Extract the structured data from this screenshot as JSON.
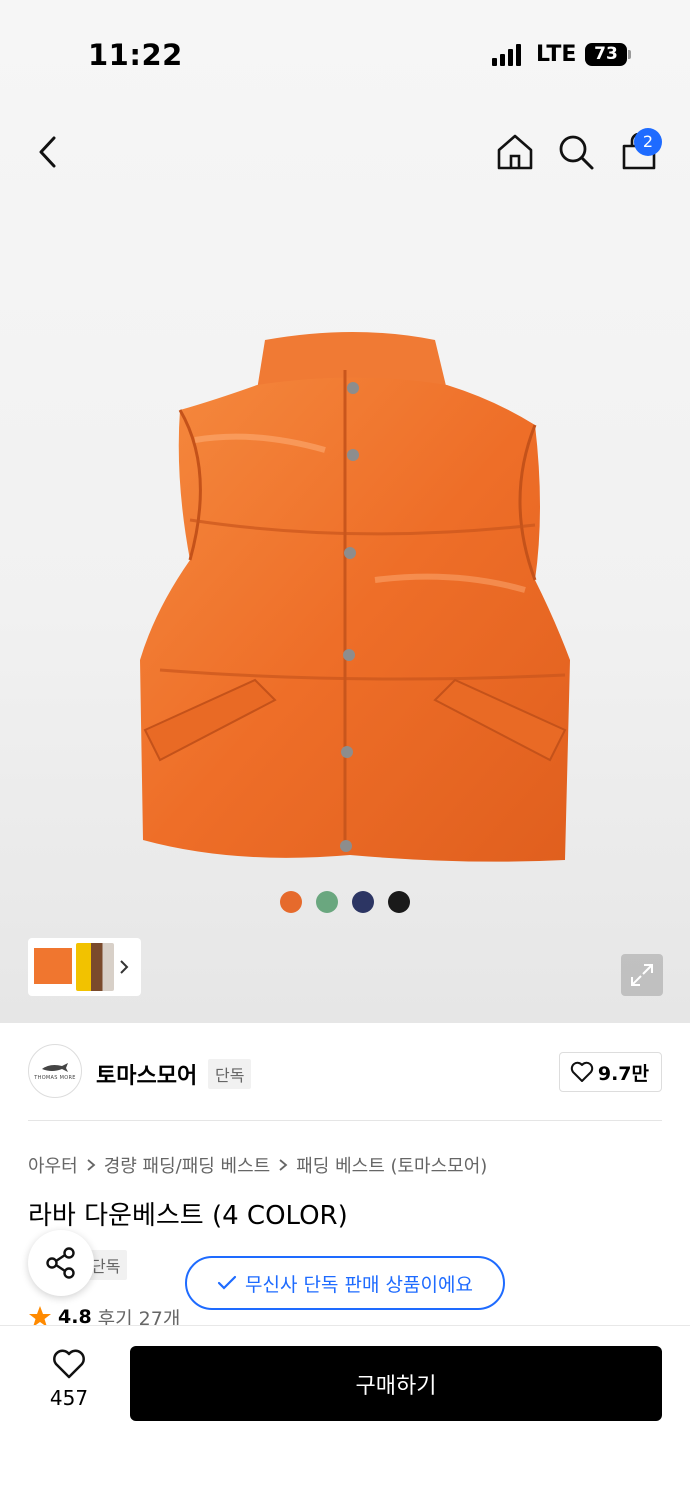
{
  "status_bar": {
    "time": "11:22",
    "network": "LTE",
    "battery": "73"
  },
  "header": {
    "cart_count": "2",
    "icons": [
      "back-icon",
      "home-icon",
      "search-icon",
      "cart-icon"
    ]
  },
  "product_image": {
    "color_swatches": [
      "#e66a2c",
      "#6aa77f",
      "#2c3563",
      "#1a1a1a"
    ],
    "expand_icon": "expand-icon"
  },
  "brand": {
    "name": "토마스모어",
    "tag": "단독",
    "likes": "9.7만"
  },
  "breadcrumb": [
    "아우터",
    "경량 패딩/패딩 베스트",
    "패딩 베스트 (토마스모어)"
  ],
  "product": {
    "title": "라바 다운베스트 (4 COLOR)",
    "exclusive_tag": "단독",
    "rating": "4.8",
    "reviews": "후기 27개"
  },
  "toast": {
    "message": "무신사 단독 판매 상품이에요"
  },
  "bottom_bar": {
    "wish_count": "457",
    "buy_label": "구매하기"
  },
  "colors": {
    "accent": "#1e6bff",
    "vest": "#f0762f",
    "star": "#ff8a00"
  }
}
